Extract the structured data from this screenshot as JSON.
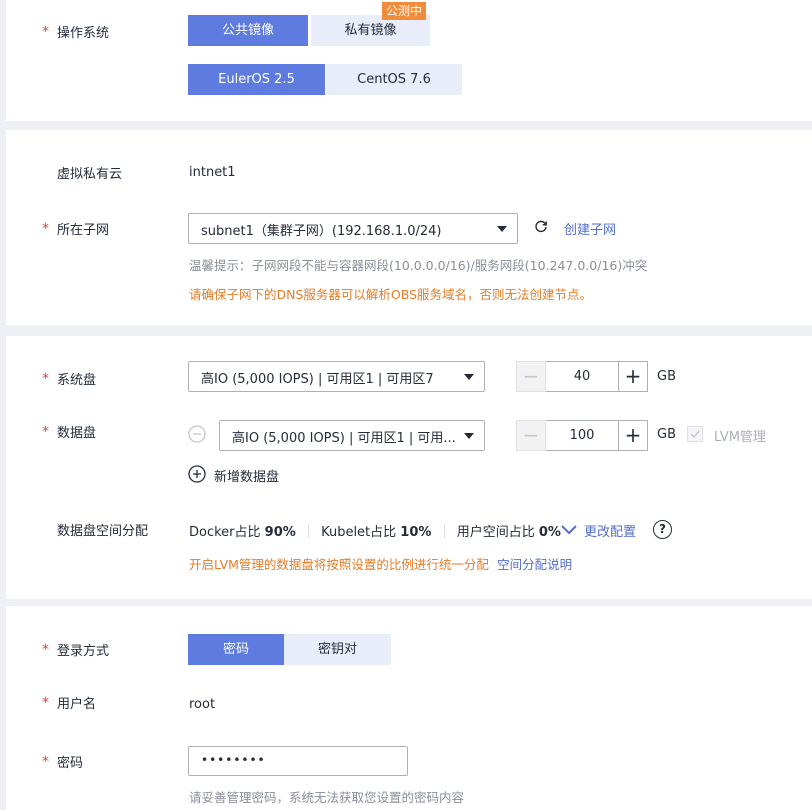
{
  "os_section": {
    "label": "操作系统",
    "image_tabs": [
      {
        "label": "公共镜像",
        "selected": true
      },
      {
        "label": "私有镜像",
        "selected": false
      }
    ],
    "beta_badge": "公测中",
    "os_options": [
      {
        "label": "EulerOS 2.5",
        "selected": true
      },
      {
        "label": "CentOS 7.6",
        "selected": false
      }
    ]
  },
  "network_section": {
    "vpc_label": "虚拟私有云",
    "vpc_value": "intnet1",
    "subnet_label": "所在子网",
    "subnet_value": "subnet1（集群子网）(192.168.1.0/24)",
    "create_subnet_link": "创建子网",
    "hint": "温馨提示：子网网段不能与容器网段(10.0.0.0/16)/服务网段(10.247.0.0/16)冲突",
    "warning": "请确保子网下的DNS服务器可以解析OBS服务域名，否则无法创建节点。"
  },
  "disk_section": {
    "system_disk_label": "系统盘",
    "system_disk_type": "高IO (5,000 IOPS) | 可用区1 | 可用区7",
    "system_disk_size": "40",
    "data_disk_label": "数据盘",
    "data_disk_type": "高IO (5,000 IOPS) | 可用区1 | 可用...",
    "data_disk_size": "100",
    "unit": "GB",
    "lvm_label": "LVM管理",
    "add_data_disk": "新增数据盘",
    "space_label": "数据盘空间分配",
    "docker_label": "Docker占比",
    "docker_value": "90%",
    "kubelet_label": "Kubelet占比",
    "kubelet_value": "10%",
    "user_label": "用户空间占比",
    "user_value": "0%",
    "change_config": "更改配置",
    "lvm_notice": "开启LVM管理的数据盘将按照设置的比例进行统一分配",
    "space_doc_link": "空间分配说明"
  },
  "login_section": {
    "login_label": "登录方式",
    "login_tabs": [
      {
        "label": "密码",
        "selected": true
      },
      {
        "label": "密钥对",
        "selected": false
      }
    ],
    "username_label": "用户名",
    "username_value": "root",
    "password_label": "密码",
    "password_value": "••••••••",
    "password_hint": "请妥善管理密码，系统无法获取您设置的密码内容"
  },
  "colors": {
    "primary": "#5e7ce0",
    "required": "#e0443a",
    "warning": "#e37d29",
    "badge": "#f08c3a",
    "link": "#526ecc"
  }
}
